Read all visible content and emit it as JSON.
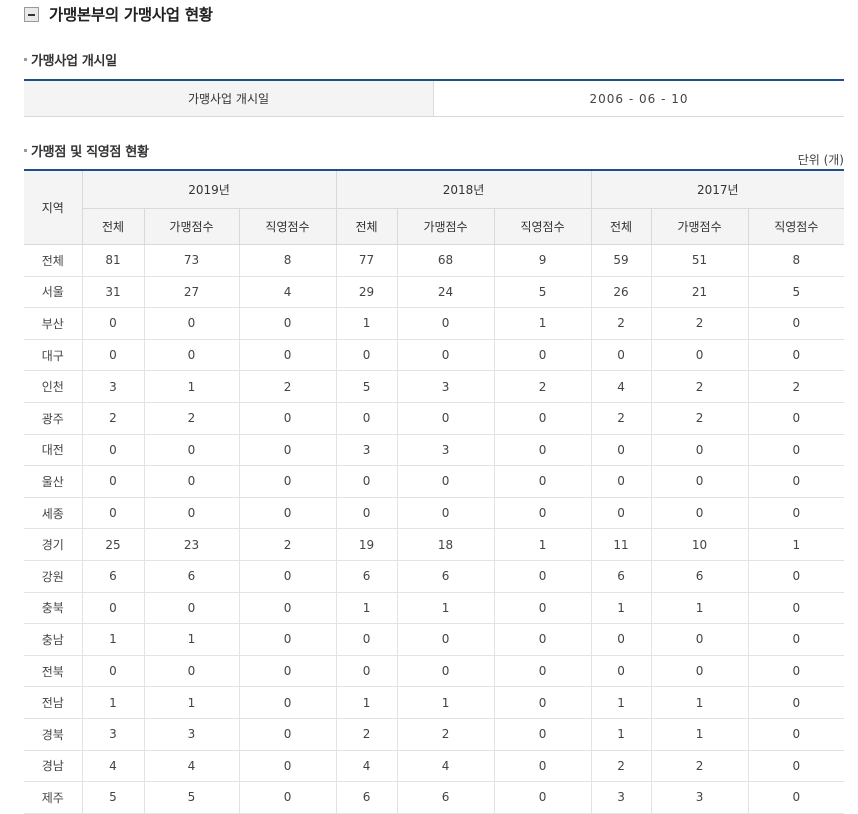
{
  "section": {
    "title": "가맹본부의 가맹사업 현황",
    "toggle_icon": "minus-icon"
  },
  "opening": {
    "subtitle": "가맹사업 개시일",
    "label": "가맹사업 개시일",
    "value": "2006 - 06 - 10"
  },
  "stores": {
    "subtitle": "가맹점 및 직영점 현황",
    "unit": "단위 (개)",
    "region_header": "지역",
    "years": [
      "2019년",
      "2018년",
      "2017년"
    ],
    "subheaders": [
      "전체",
      "가맹점수",
      "직영점수"
    ],
    "rows": [
      {
        "region": "전체",
        "v": [
          "81",
          "73",
          "8",
          "77",
          "68",
          "9",
          "59",
          "51",
          "8"
        ]
      },
      {
        "region": "서울",
        "v": [
          "31",
          "27",
          "4",
          "29",
          "24",
          "5",
          "26",
          "21",
          "5"
        ]
      },
      {
        "region": "부산",
        "v": [
          "0",
          "0",
          "0",
          "1",
          "0",
          "1",
          "2",
          "2",
          "0"
        ]
      },
      {
        "region": "대구",
        "v": [
          "0",
          "0",
          "0",
          "0",
          "0",
          "0",
          "0",
          "0",
          "0"
        ]
      },
      {
        "region": "인천",
        "v": [
          "3",
          "1",
          "2",
          "5",
          "3",
          "2",
          "4",
          "2",
          "2"
        ]
      },
      {
        "region": "광주",
        "v": [
          "2",
          "2",
          "0",
          "0",
          "0",
          "0",
          "2",
          "2",
          "0"
        ]
      },
      {
        "region": "대전",
        "v": [
          "0",
          "0",
          "0",
          "3",
          "3",
          "0",
          "0",
          "0",
          "0"
        ]
      },
      {
        "region": "울산",
        "v": [
          "0",
          "0",
          "0",
          "0",
          "0",
          "0",
          "0",
          "0",
          "0"
        ]
      },
      {
        "region": "세종",
        "v": [
          "0",
          "0",
          "0",
          "0",
          "0",
          "0",
          "0",
          "0",
          "0"
        ]
      },
      {
        "region": "경기",
        "v": [
          "25",
          "23",
          "2",
          "19",
          "18",
          "1",
          "11",
          "10",
          "1"
        ]
      },
      {
        "region": "강원",
        "v": [
          "6",
          "6",
          "0",
          "6",
          "6",
          "0",
          "6",
          "6",
          "0"
        ]
      },
      {
        "region": "충북",
        "v": [
          "0",
          "0",
          "0",
          "1",
          "1",
          "0",
          "1",
          "1",
          "0"
        ]
      },
      {
        "region": "충남",
        "v": [
          "1",
          "1",
          "0",
          "0",
          "0",
          "0",
          "0",
          "0",
          "0"
        ]
      },
      {
        "region": "전북",
        "v": [
          "0",
          "0",
          "0",
          "0",
          "0",
          "0",
          "0",
          "0",
          "0"
        ]
      },
      {
        "region": "전남",
        "v": [
          "1",
          "1",
          "0",
          "1",
          "1",
          "0",
          "1",
          "1",
          "0"
        ]
      },
      {
        "region": "경북",
        "v": [
          "3",
          "3",
          "0",
          "2",
          "2",
          "0",
          "1",
          "1",
          "0"
        ]
      },
      {
        "region": "경남",
        "v": [
          "4",
          "4",
          "0",
          "4",
          "4",
          "0",
          "2",
          "2",
          "0"
        ]
      },
      {
        "region": "제주",
        "v": [
          "5",
          "5",
          "0",
          "6",
          "6",
          "0",
          "3",
          "3",
          "0"
        ]
      }
    ]
  }
}
